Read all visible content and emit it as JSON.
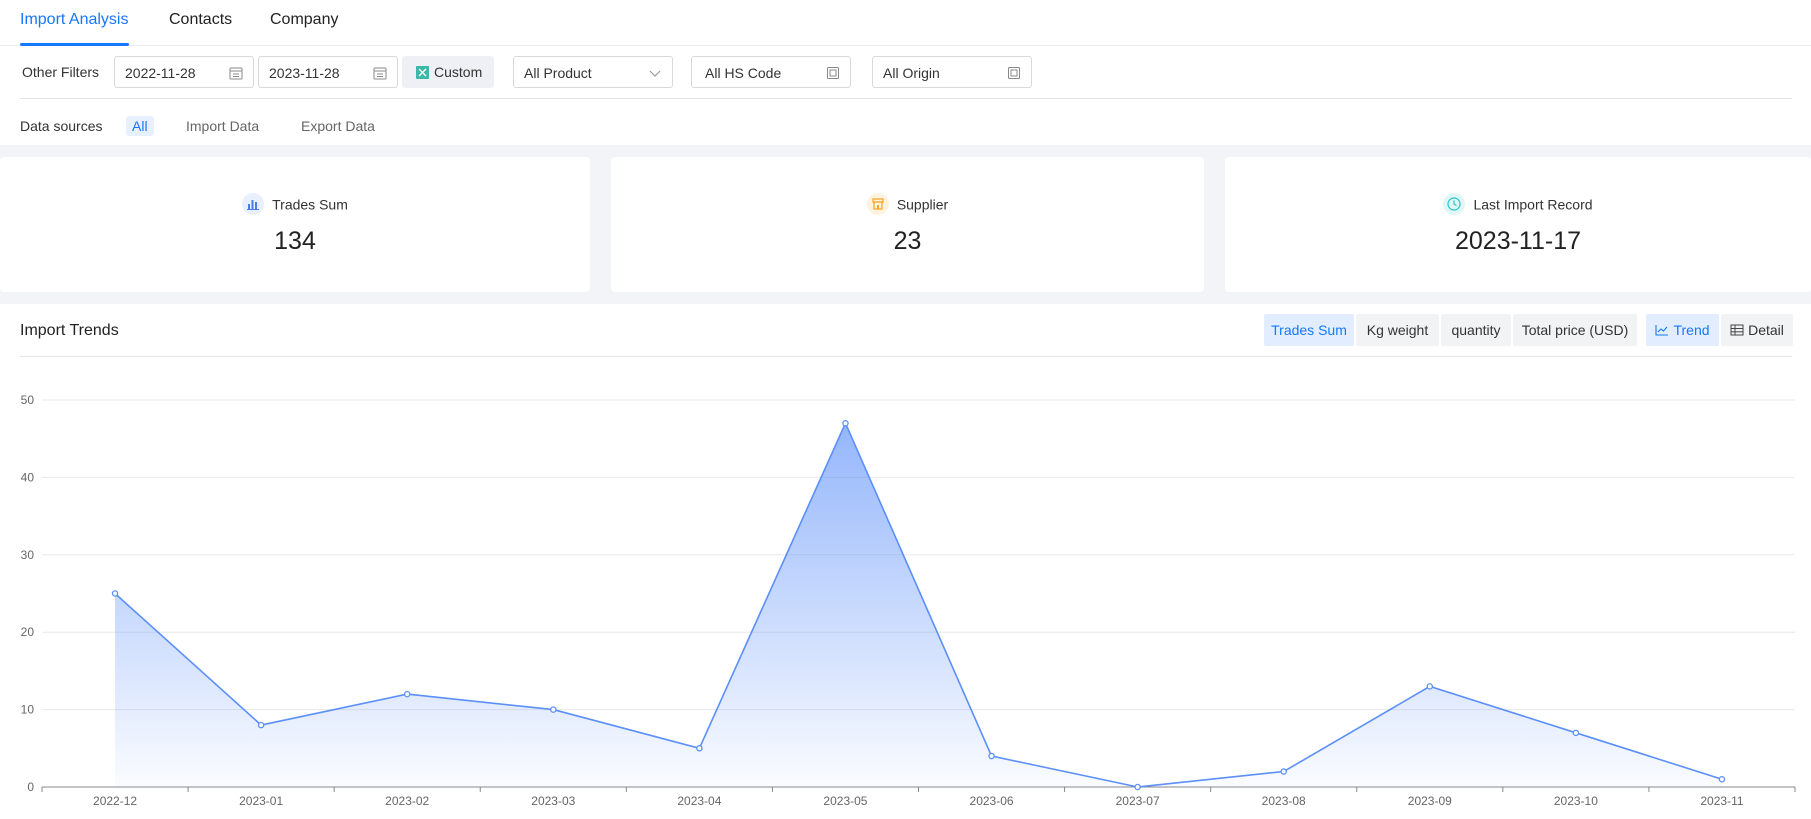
{
  "tabs": [
    {
      "label": "Import Analysis",
      "active": true
    },
    {
      "label": "Contacts",
      "active": false
    },
    {
      "label": "Company",
      "active": false
    }
  ],
  "filters": {
    "label": "Other Filters",
    "date_from": "2022-11-28",
    "date_to": "2023-11-28",
    "custom_label": "Custom",
    "product": "All Product",
    "hs_code": "All HS Code",
    "origin": "All Origin"
  },
  "data_sources": {
    "label": "Data sources",
    "options": [
      "All",
      "Import Data",
      "Export Data"
    ],
    "active": "All"
  },
  "stats": [
    {
      "label": "Trades Sum",
      "value": "134",
      "icon": "bar-chart-icon",
      "color": "#4a7cf0"
    },
    {
      "label": "Supplier",
      "value": "23",
      "icon": "store-icon",
      "color": "#f5a623"
    },
    {
      "label": "Last Import Record",
      "value": "2023-11-17",
      "icon": "clock-icon",
      "color": "#26c6c6"
    }
  ],
  "trends": {
    "title": "Import Trends",
    "metrics": [
      "Trades Sum",
      "Kg weight",
      "quantity",
      "Total price (USD)"
    ],
    "active_metric": "Trades Sum",
    "views": [
      "Trend",
      "Detail"
    ],
    "active_view": "Trend"
  },
  "colors": {
    "accent": "#1677ff",
    "line": "#5b8ff9"
  },
  "chart_data": {
    "type": "area",
    "categories": [
      "2022-12",
      "2023-01",
      "2023-02",
      "2023-03",
      "2023-04",
      "2023-05",
      "2023-06",
      "2023-07",
      "2023-08",
      "2023-09",
      "2023-10",
      "2023-11"
    ],
    "series": [
      {
        "values": [
          25,
          8,
          12,
          10,
          5,
          47,
          4,
          0,
          2,
          13,
          7,
          1
        ]
      }
    ],
    "title": "",
    "xlabel": "",
    "ylabel": "",
    "ylim": [
      0,
      50
    ],
    "yticks": [
      0,
      10,
      20,
      30,
      40,
      50
    ],
    "grid": true,
    "legend": "none"
  }
}
